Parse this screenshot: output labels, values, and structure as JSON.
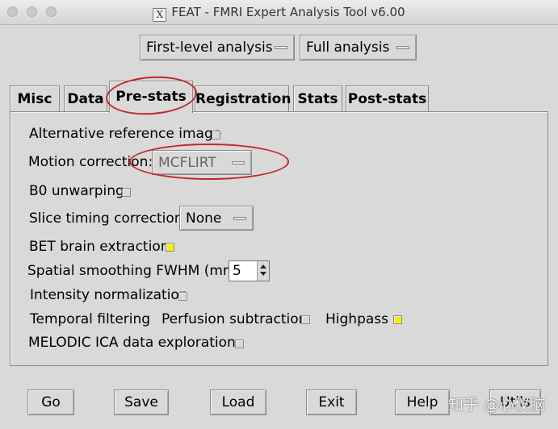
{
  "window": {
    "title": "FEAT - FMRI Expert Analysis Tool v6.00",
    "title_icon_glyph": "X"
  },
  "top_menus": {
    "analysis_level": "First-level analysis",
    "analysis_type": "Full analysis"
  },
  "tabs": [
    {
      "label": "Misc"
    },
    {
      "label": "Data"
    },
    {
      "label": "Pre-stats"
    },
    {
      "label": "Registration"
    },
    {
      "label": "Stats"
    },
    {
      "label": "Post-stats"
    }
  ],
  "prestats": {
    "alt_ref_label": "Alternative reference image",
    "alt_ref_checked": false,
    "motion_label": "Motion correction:",
    "motion_value": "MCFLIRT",
    "b0_label": "B0 unwarping",
    "b0_checked": false,
    "slice_timing_label": "Slice timing correction:",
    "slice_timing_value": "None",
    "bet_label": "BET brain extraction",
    "bet_checked": true,
    "smoothing_label": "Spatial smoothing FWHM (mm)",
    "smoothing_value": "5",
    "intensity_label": "Intensity normalization",
    "intensity_checked": false,
    "temporal_label": "Temporal filtering",
    "perfusion_label": "Perfusion subtraction",
    "perfusion_checked": false,
    "highpass_label": "Highpass",
    "highpass_checked": true,
    "melodic_label": "MELODIC ICA data exploration",
    "melodic_checked": false
  },
  "buttons": {
    "go": "Go",
    "save": "Save",
    "load": "Load",
    "exit": "Exit",
    "help": "Help",
    "utils": "Utils"
  },
  "watermark": "知乎 @心仪脑",
  "colors": {
    "window_bg": "#d9d9d9",
    "checked": "#f5f000",
    "annotation_ring": "#c1272d"
  }
}
